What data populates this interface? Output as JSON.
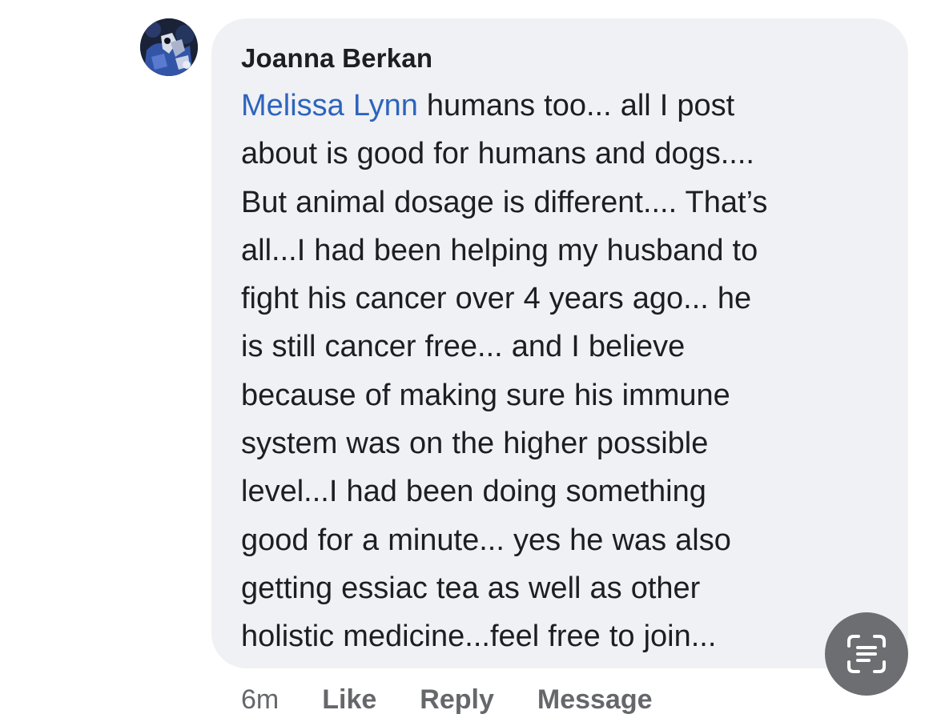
{
  "comment": {
    "author": "Joanna Berkan",
    "mention": "Melissa Lynn",
    "text": " humans too... all I post\nabout is good for humans and dogs....\nBut animal dosage is different.... That’s\nall...I had been helping my husband to\nfight his cancer over 4 years ago... he\nis still cancer free... and I believe\nbecause of making sure his immune\nsystem was on the higher possible\nlevel...I had been doing something\ngood for a minute... yes he was also\ngetting essiac tea as well as other\nholistic medicine...feel free to join...",
    "time": "6m",
    "actions": {
      "like": "Like",
      "reply": "Reply",
      "message": "Message"
    }
  },
  "icons": {
    "avatar": "profile-photo",
    "scan": "live-text-scan-icon"
  },
  "colors": {
    "bubble": "#f0f1f5",
    "text": "#1c1e21",
    "mention": "#2d64bc",
    "meta": "#65676b",
    "scan_button": "#6d6e72"
  }
}
